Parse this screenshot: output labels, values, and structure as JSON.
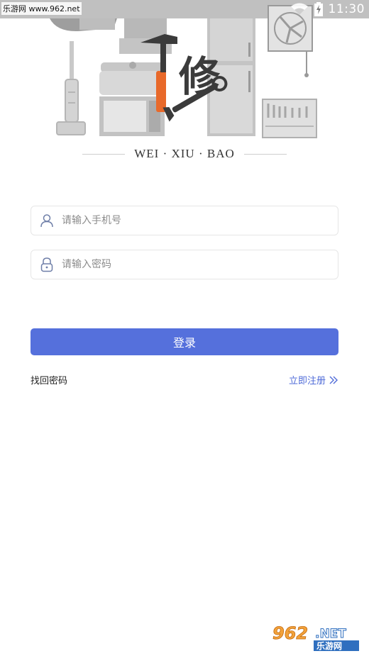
{
  "status_bar": {
    "watermark": "乐游网 www.962.net",
    "time": "11:30"
  },
  "brand": {
    "logo_char": "修",
    "name": "WEI · XIU · BAO"
  },
  "form": {
    "phone_placeholder": "请输入手机号",
    "password_placeholder": "请输入密码",
    "login_label": "登录",
    "forgot_label": "找回密码",
    "register_label": "立即注册"
  },
  "watermark": {
    "digits": "962",
    "suffix": ".NET",
    "site_name": "乐游网"
  },
  "colors": {
    "primary": "#5570dc",
    "link": "#4f6bd8",
    "logo_orange": "#e8692a",
    "logo_dark": "#3b3b3b",
    "appliance_gray": "#9a9a9a"
  },
  "icons": [
    "user-icon",
    "lock-icon",
    "double-chevron-right-icon",
    "wifi-icon",
    "battery-icon",
    "hammer-icon",
    "wrench-icon"
  ]
}
